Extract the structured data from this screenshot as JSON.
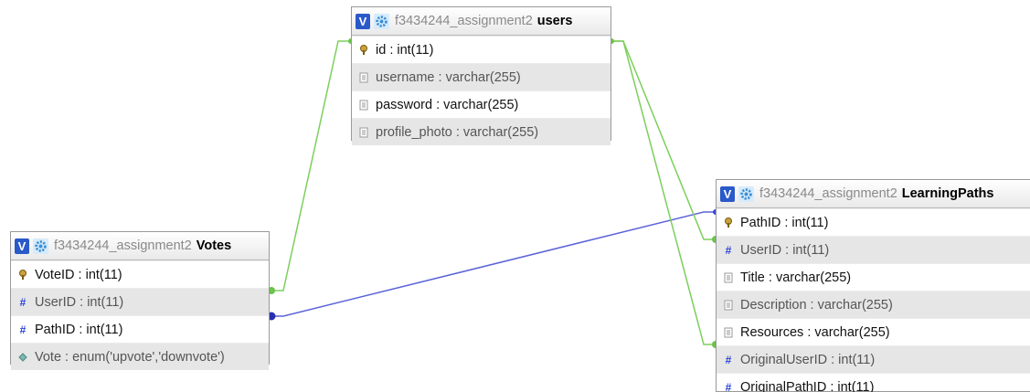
{
  "tables": {
    "users": {
      "db": "f3434244_assignment2",
      "name": "users",
      "columns": [
        {
          "label": "id : int(11)",
          "icon": "primary-key-icon"
        },
        {
          "label": "username : varchar(255)",
          "icon": "text-column-icon"
        },
        {
          "label": "password : varchar(255)",
          "icon": "text-column-icon"
        },
        {
          "label": "profile_photo : varchar(255)",
          "icon": "text-column-icon"
        }
      ]
    },
    "votes": {
      "db": "f3434244_assignment2",
      "name": "Votes",
      "columns": [
        {
          "label": "VoteID : int(11)",
          "icon": "primary-key-icon"
        },
        {
          "label": "UserID : int(11)",
          "icon": "numeric-column-icon"
        },
        {
          "label": "PathID : int(11)",
          "icon": "numeric-column-icon"
        },
        {
          "label": "Vote : enum('upvote','downvote')",
          "icon": "enum-column-icon"
        }
      ]
    },
    "learningpaths": {
      "db": "f3434244_assignment2",
      "name": "LearningPaths",
      "columns": [
        {
          "label": "PathID : int(11)",
          "icon": "primary-key-icon"
        },
        {
          "label": "UserID : int(11)",
          "icon": "numeric-column-icon"
        },
        {
          "label": "Title : varchar(255)",
          "icon": "text-column-icon"
        },
        {
          "label": "Description : varchar(255)",
          "icon": "text-column-icon"
        },
        {
          "label": "Resources : varchar(255)",
          "icon": "text-column-icon"
        },
        {
          "label": "OriginalUserID : int(11)",
          "icon": "numeric-column-icon"
        },
        {
          "label": "OriginalPathID : int(11)",
          "icon": "numeric-column-icon"
        }
      ]
    }
  },
  "header_buttons": {
    "toggle_label": "V",
    "toggle_icon": "toggle-v-icon",
    "options_icon": "gear-icon"
  },
  "relations": [
    {
      "from": "votes.UserID",
      "to": "users.id",
      "color": "#6cc24a"
    },
    {
      "from": "votes.PathID",
      "to": "learningpaths.PathID",
      "color": "#3a47d6"
    },
    {
      "from": "learningpaths.UserID",
      "to": "users.id",
      "color": "#6cc24a"
    },
    {
      "from": "learningpaths.OriginalUserID",
      "to": "users.id",
      "color": "#6cc24a"
    }
  ],
  "colors": {
    "fk_green": "#6cc24a",
    "fk_blue": "#3a47d6",
    "header_blue": "#2a59c9"
  }
}
